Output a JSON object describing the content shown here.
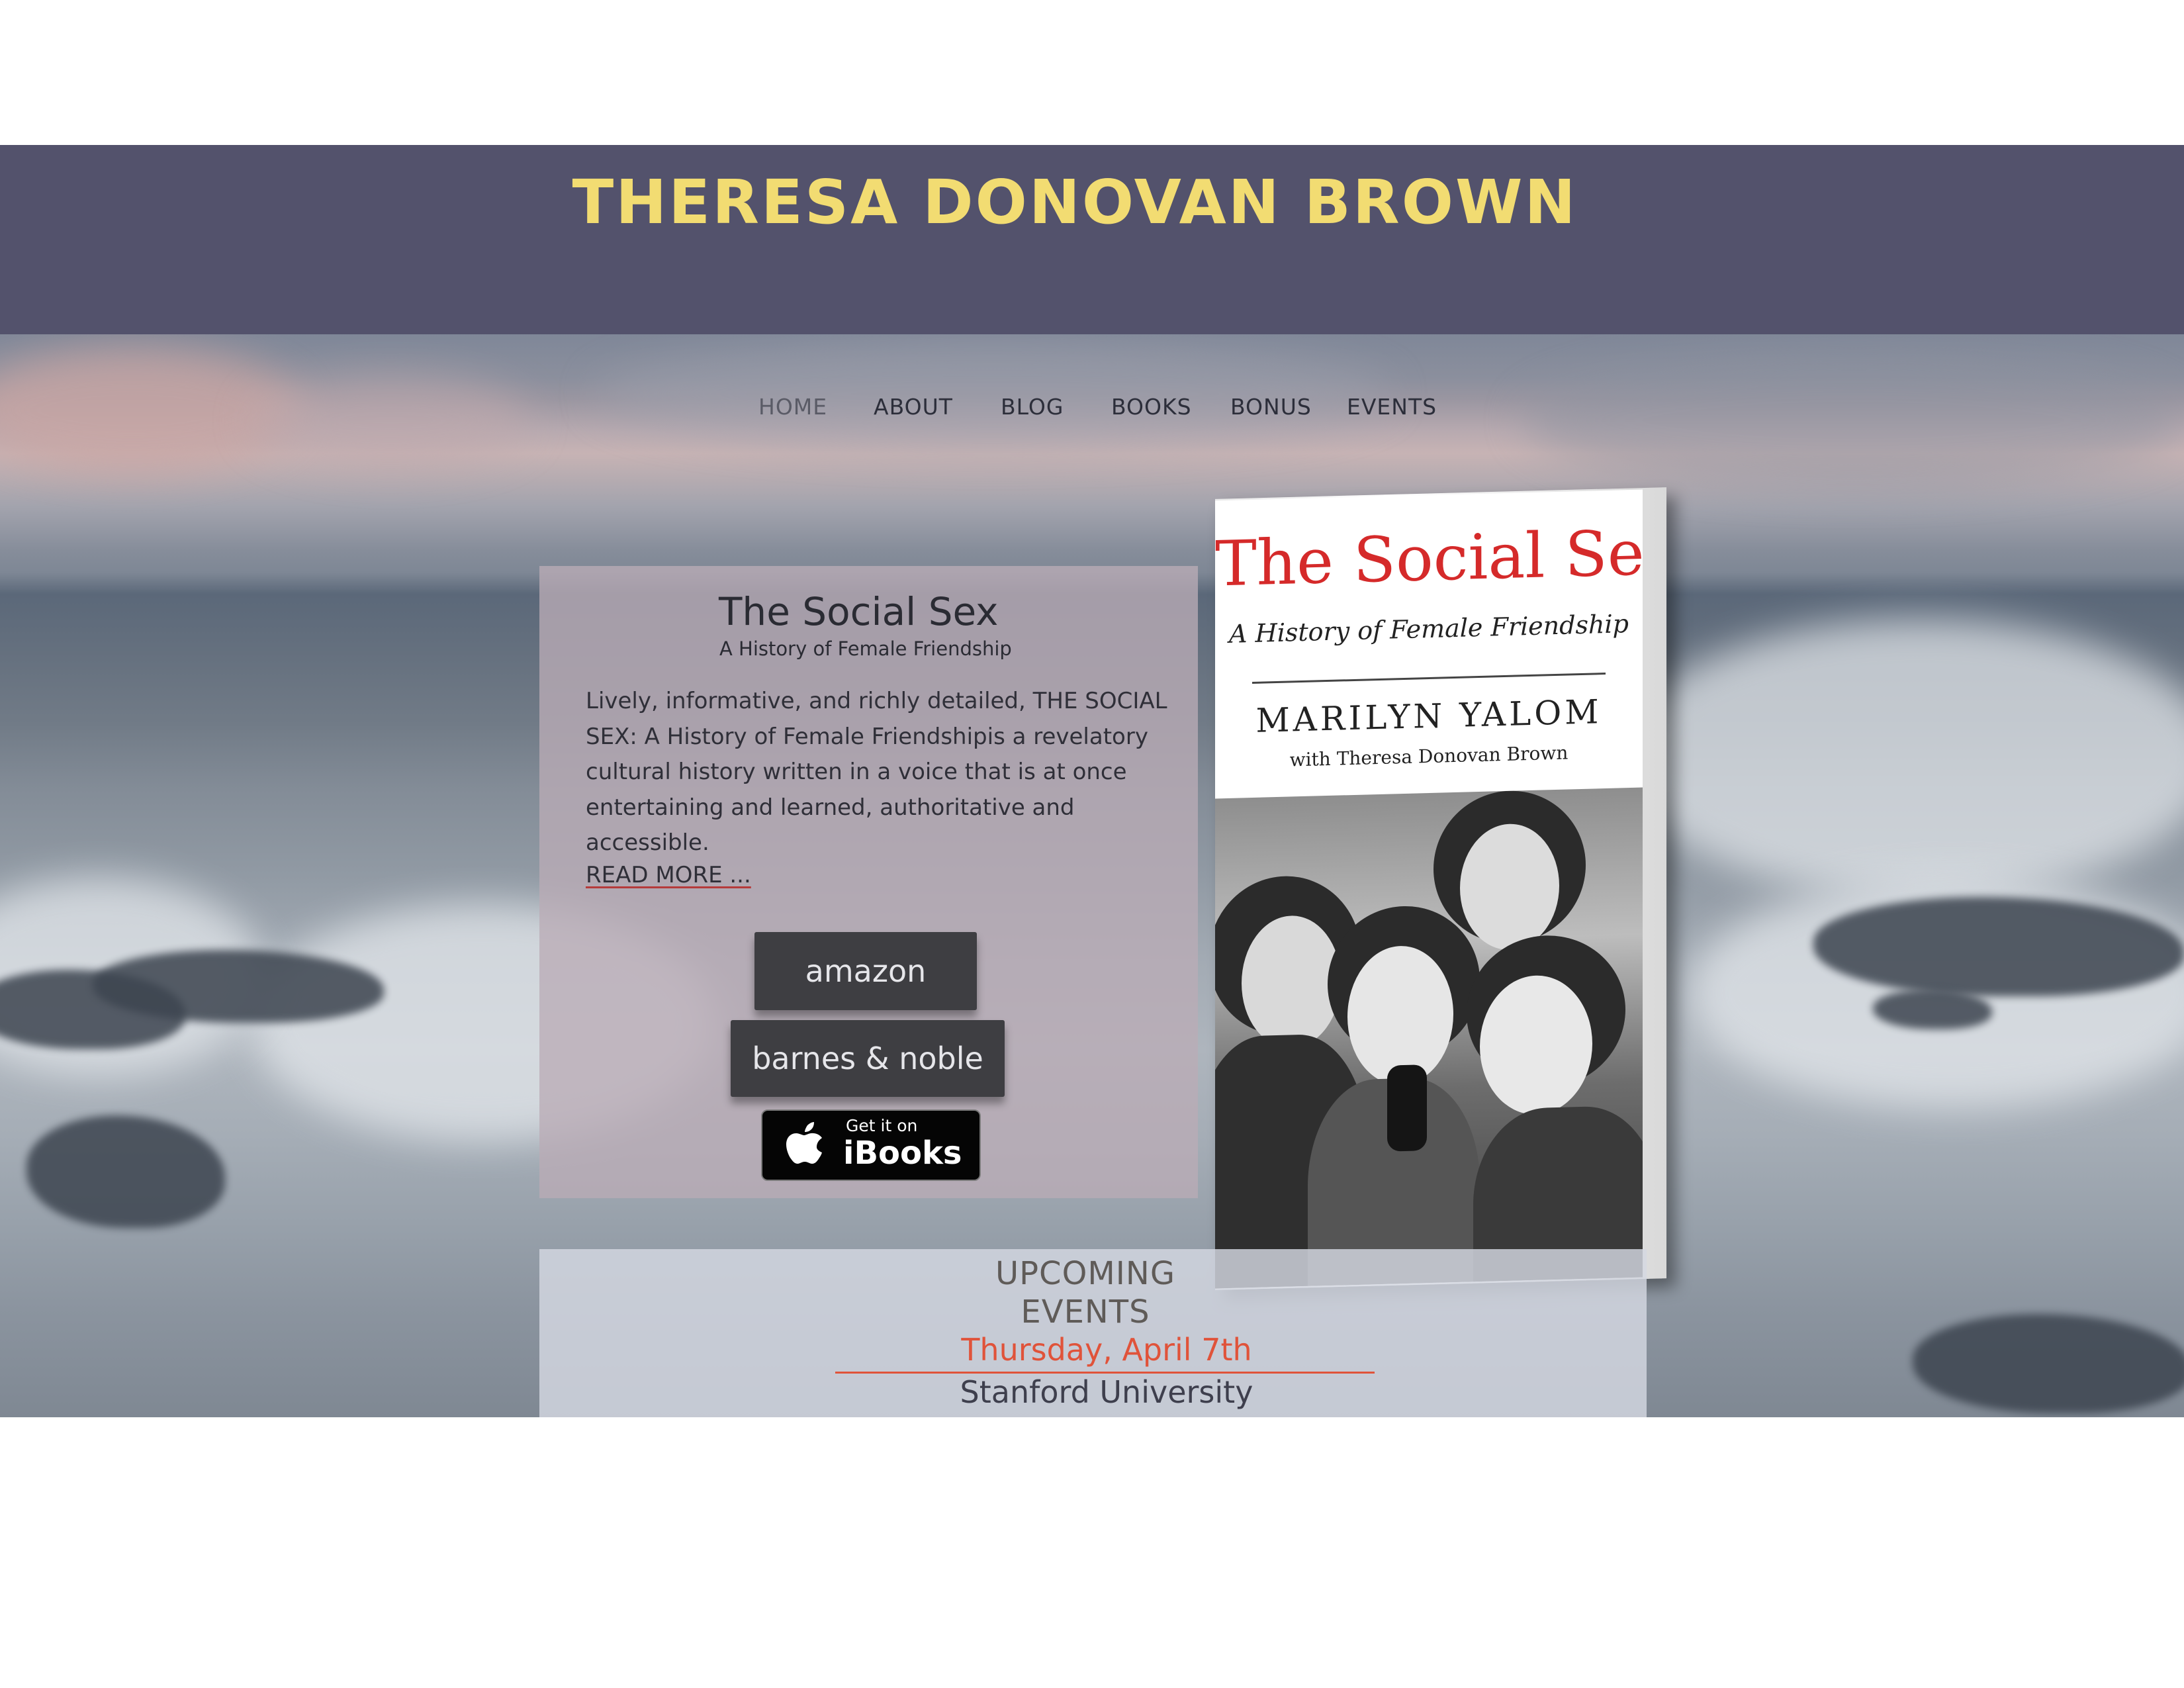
{
  "site": {
    "title": "THERESA DONOVAN BROWN"
  },
  "nav": {
    "items": [
      {
        "label": "HOME",
        "active": true
      },
      {
        "label": "ABOUT",
        "active": false
      },
      {
        "label": "BLOG",
        "active": false
      },
      {
        "label": "BOOKS",
        "active": false
      },
      {
        "label": "BONUS",
        "active": false
      },
      {
        "label": "EVENTS",
        "active": false
      }
    ]
  },
  "book": {
    "title": "The Social Sex",
    "subtitle": "A History of Female Friendship",
    "blurb": "Lively, informative, and richly detailed, THE SOCIAL SEX: A History of Female Friendshipis a revelatory cultural history written in a voice that is at once entertaining and learned, authoritative and accessible.",
    "read_more": "READ MORE ..."
  },
  "buy_buttons": {
    "amazon": "amazon",
    "barnes_noble": "barnes & noble",
    "ibooks_get": "Get it on",
    "ibooks_name": "iBooks",
    "ibooks_icon": "apple-icon"
  },
  "cover": {
    "title": "The Social Sex",
    "subtitle": "A History of Female Friendship",
    "author": "MARILYN YALOM",
    "coauthor": "with Theresa Donovan Brown"
  },
  "events": {
    "heading_line1": "UPCOMING",
    "heading_line2": "EVENTS",
    "date": "Thursday, April 7th",
    "place": "Stanford University"
  },
  "colors": {
    "header_bg": "#53526c",
    "title_yellow": "#f2dc72",
    "event_accent": "#e0533a",
    "cover_title_red": "#d52a2a"
  }
}
